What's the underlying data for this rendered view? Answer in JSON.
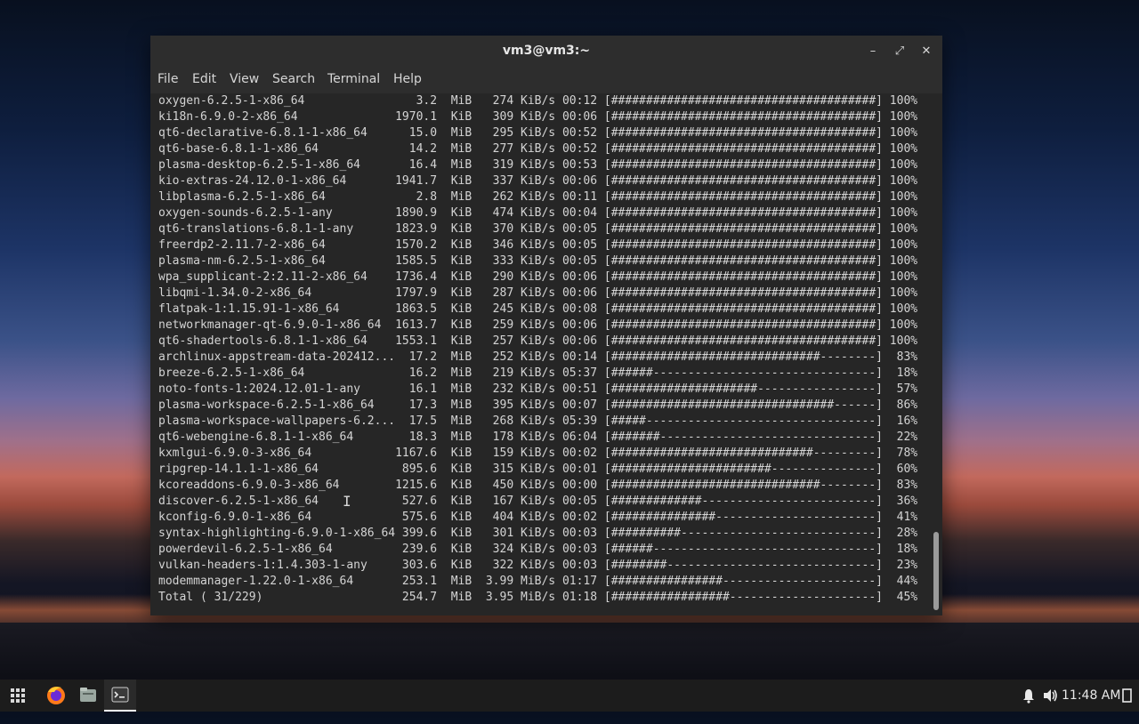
{
  "window": {
    "title": "vm3@vm3:~",
    "controls": {
      "minimize": "–",
      "maximize": "⤢",
      "close": "✕"
    }
  },
  "menu": [
    "File",
    "Edit",
    "View",
    "Search",
    "Terminal",
    "Help"
  ],
  "terminal": {
    "lines": [
      "oxygen-6.2.5-1-x86_64                3.2  MiB   274 KiB/s 00:12 [######################################] 100%",
      "ki18n-6.9.0-2-x86_64              1970.1  KiB   309 KiB/s 00:06 [######################################] 100%",
      "qt6-declarative-6.8.1-1-x86_64      15.0  MiB   295 KiB/s 00:52 [######################################] 100%",
      "qt6-base-6.8.1-1-x86_64             14.2  MiB   277 KiB/s 00:52 [######################################] 100%",
      "plasma-desktop-6.2.5-1-x86_64       16.4  MiB   319 KiB/s 00:53 [######################################] 100%",
      "kio-extras-24.12.0-1-x86_64       1941.7  KiB   337 KiB/s 00:06 [######################################] 100%",
      "libplasma-6.2.5-1-x86_64             2.8  MiB   262 KiB/s 00:11 [######################################] 100%",
      "oxygen-sounds-6.2.5-1-any         1890.9  KiB   474 KiB/s 00:04 [######################################] 100%",
      "qt6-translations-6.8.1-1-any      1823.9  KiB   370 KiB/s 00:05 [######################################] 100%",
      "freerdp2-2.11.7-2-x86_64          1570.2  KiB   346 KiB/s 00:05 [######################################] 100%",
      "plasma-nm-6.2.5-1-x86_64          1585.5  KiB   333 KiB/s 00:05 [######################################] 100%",
      "wpa_supplicant-2:2.11-2-x86_64    1736.4  KiB   290 KiB/s 00:06 [######################################] 100%",
      "libqmi-1.34.0-2-x86_64            1797.9  KiB   287 KiB/s 00:06 [######################################] 100%",
      "flatpak-1:1.15.91-1-x86_64        1863.5  KiB   245 KiB/s 00:08 [######################################] 100%",
      "networkmanager-qt-6.9.0-1-x86_64  1613.7  KiB   259 KiB/s 00:06 [######################################] 100%",
      "qt6-shadertools-6.8.1-1-x86_64    1553.1  KiB   257 KiB/s 00:06 [######################################] 100%",
      "archlinux-appstream-data-202412...  17.2  MiB   252 KiB/s 00:14 [##############################--------]  83%",
      "breeze-6.2.5-1-x86_64               16.2  MiB   219 KiB/s 05:37 [######--------------------------------]  18%",
      "noto-fonts-1:2024.12.01-1-any       16.1  MiB   232 KiB/s 00:51 [#####################-----------------]  57%",
      "plasma-workspace-6.2.5-1-x86_64     17.3  MiB   395 KiB/s 00:07 [################################------]  86%",
      "plasma-workspace-wallpapers-6.2...  17.5  MiB   268 KiB/s 05:39 [#####---------------------------------]  16%",
      "qt6-webengine-6.8.1-1-x86_64        18.3  MiB   178 KiB/s 06:04 [#######-------------------------------]  22%",
      "kxmlgui-6.9.0-3-x86_64            1167.6  KiB   159 KiB/s 00:02 [#############################---------]  78%",
      "ripgrep-14.1.1-1-x86_64            895.6  KiB   315 KiB/s 00:01 [#######################---------------]  60%",
      "kcoreaddons-6.9.0-3-x86_64        1215.6  KiB   450 KiB/s 00:00 [##############################--------]  83%",
      "discover-6.2.5-1-x86_64            527.6  KiB   167 KiB/s 00:05 [#############-------------------------]  36%",
      "kconfig-6.9.0-1-x86_64             575.6  KiB   404 KiB/s 00:02 [###############-----------------------]  41%",
      "syntax-highlighting-6.9.0-1-x86_64 399.6  KiB   301 KiB/s 00:03 [##########----------------------------]  28%",
      "powerdevil-6.2.5-1-x86_64          239.6  KiB   324 KiB/s 00:03 [######--------------------------------]  18%",
      "vulkan-headers-1:1.4.303-1-any     303.6  KiB   322 KiB/s 00:03 [########------------------------------]  23%",
      "modemmanager-1.22.0-1-x86_64       253.1  MiB  3.99 MiB/s 01:17 [################----------------------]  44%",
      "Total ( 31/229)                    254.7  MiB  3.95 MiB/s 01:18 [#################---------------------]  45%"
    ]
  },
  "taskbar": {
    "apps": [
      "app-launcher-icon",
      "firefox-icon",
      "files-icon",
      "terminal-icon"
    ],
    "clock": "11:48 AM"
  }
}
